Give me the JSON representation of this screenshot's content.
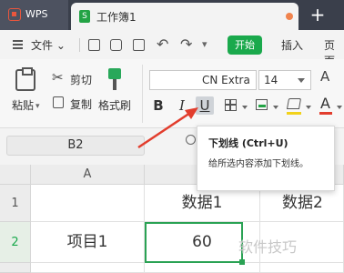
{
  "titlebar": {
    "app_tab": "WPS",
    "doc_tab": "工作簿1",
    "new_tab": "+"
  },
  "menu": {
    "file": "文件",
    "start": "开始",
    "insert": "插入",
    "page": "页面"
  },
  "ribbon": {
    "paste": "粘贴",
    "cut": "剪切",
    "copy": "复制",
    "format_painter": "格式刷",
    "font": "CN Extra",
    "size": "14",
    "bold": "B",
    "italic": "I",
    "underline": "U",
    "font_color": "A"
  },
  "formula_bar": {
    "name_box": "B2"
  },
  "sheet": {
    "columns": [
      "A"
    ],
    "rows": [
      "1",
      "2"
    ],
    "cells": {
      "b1": "数据1",
      "c1": "数据2",
      "a2": "项目1",
      "b2": "60"
    }
  },
  "tooltip": {
    "title": "下划线 (Ctrl+U)",
    "description": "给所选内容添加下划线。"
  },
  "watermark": "软件技巧",
  "colors": {
    "accent": "#1aa94c",
    "arrow": "#e23d2d"
  }
}
